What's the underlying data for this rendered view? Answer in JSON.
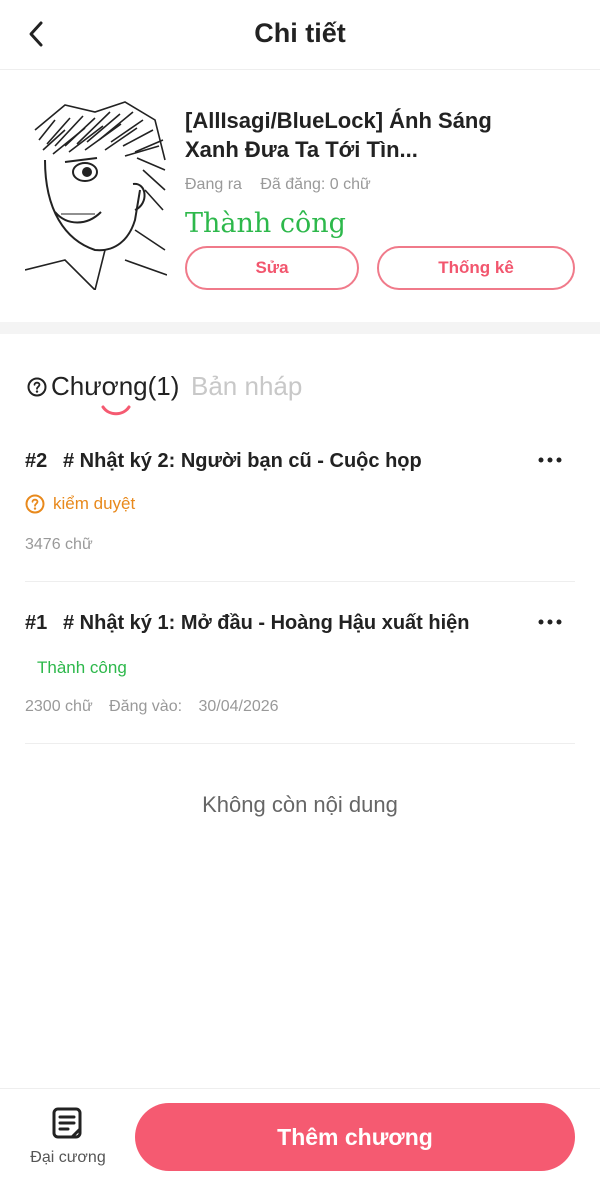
{
  "header": {
    "title": "Chi tiết",
    "back_icon": "chevron-left-icon"
  },
  "book": {
    "title": "[AllIsagi/BlueLock] Ánh Sáng Xanh Đưa Ta Tới Tìn...",
    "state": "Đang ra",
    "published": "Đã đăng: 0 chữ",
    "status": "Thành công",
    "edit_label": "Sửa",
    "stats_label": "Thống kê"
  },
  "tabs": {
    "chapters_label": "Chương(1)",
    "drafts_label": "Bản nháp"
  },
  "chapters": [
    {
      "number": "#2",
      "title": "# Nhật ký 2: Người bạn cũ - Cuộc họp",
      "status": "kiểm duyệt",
      "words": "3476 chữ"
    },
    {
      "number": "#1",
      "title": "# Nhật ký 1: Mở đầu - Hoàng Hậu xuất hiện",
      "status": "Thành công",
      "words": "2300 chữ",
      "published_label": "Đăng vào:",
      "published_date": "30/04/2026"
    }
  ],
  "no_more_text": "Không còn nội dung",
  "bottom": {
    "outline_label": "Đại cương",
    "add_chapter_label": "Thêm chương"
  },
  "colors": {
    "accent": "#f55a71",
    "success": "#2db84b",
    "warning": "#e8891c"
  }
}
